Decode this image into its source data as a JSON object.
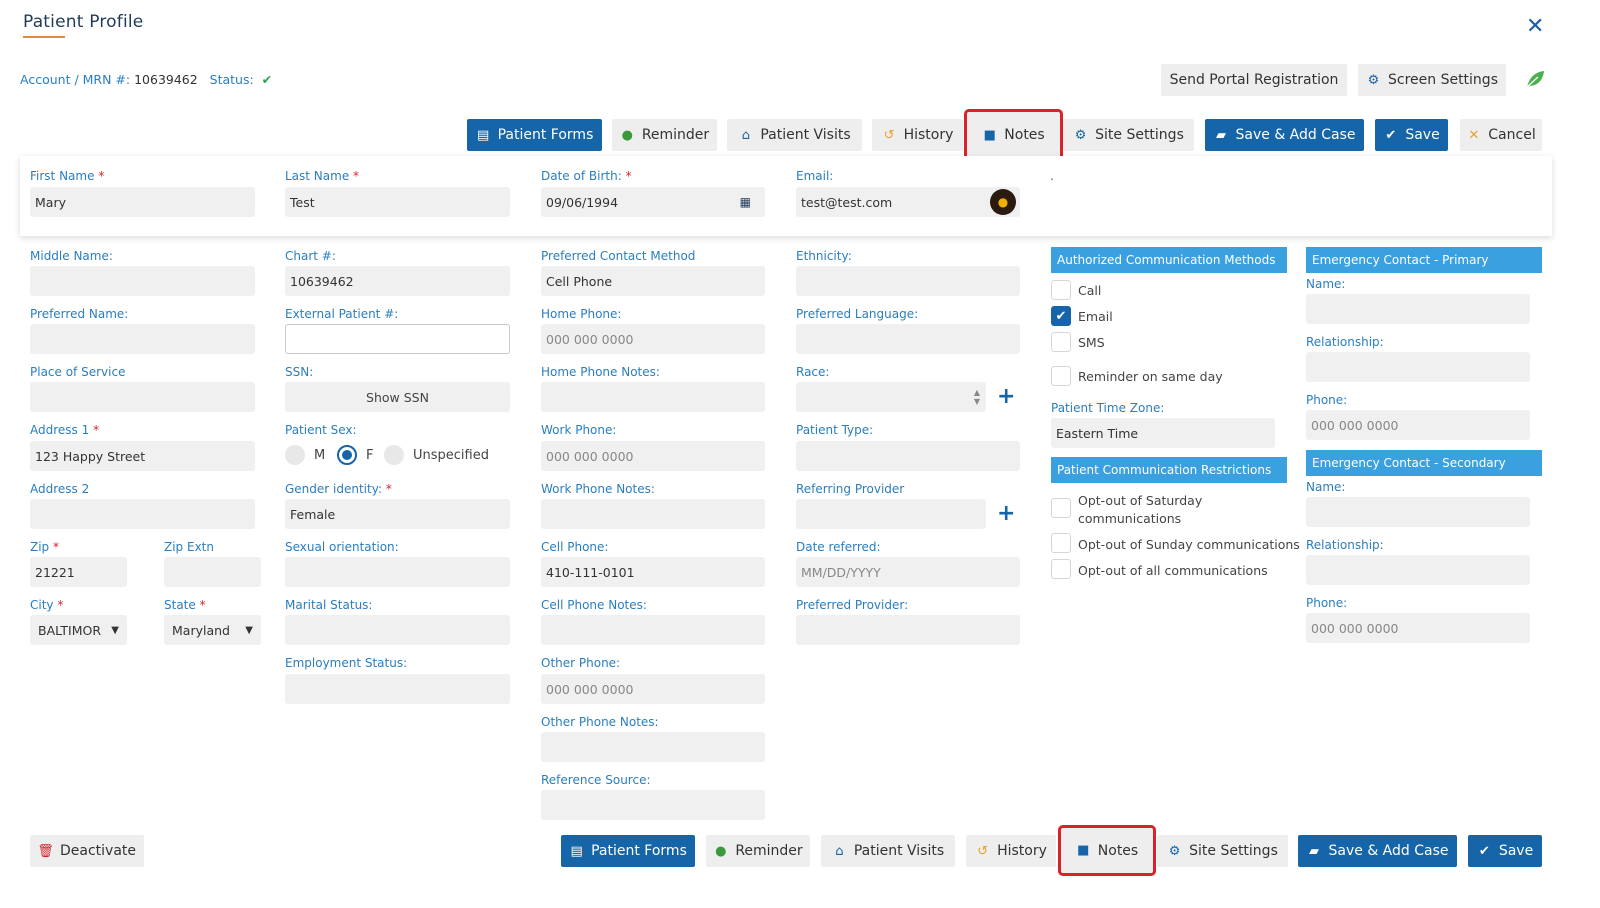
{
  "header": {
    "title": "Patient Profile",
    "account_label": "Account / MRN #:",
    "mrn": "10639462",
    "status_label": "Status:",
    "status_check": "✔"
  },
  "top_actions": {
    "send_portal": "Send Portal Registration",
    "screen_settings": "Screen Settings"
  },
  "toolbar": {
    "patient_forms": "Patient Forms",
    "reminder": "Reminder",
    "patient_visits": "Patient Visits",
    "history": "History",
    "notes": "Notes",
    "site_settings": "Site Settings",
    "save_add_case": "Save & Add Case",
    "save": "Save",
    "cancel": "Cancel",
    "deactivate": "Deactivate"
  },
  "card": {
    "first_name_label": "First Name",
    "first_name": "Mary",
    "last_name_label": "Last Name",
    "last_name": "Test",
    "dob_label": "Date of Birth:",
    "dob": "09/06/1994",
    "email_label": "Email:",
    "email": "test@test.com",
    "dot": "."
  },
  "col1": {
    "middle_name": "Middle Name:",
    "preferred_name": "Preferred Name:",
    "place_of_service": "Place of Service",
    "address1": "Address 1",
    "address1_value": "123 Happy Street",
    "address2": "Address 2",
    "zip": "Zip",
    "zip_value": "21221",
    "zip_extn": "Zip Extn",
    "city": "City",
    "city_value": "BALTIMOR",
    "state": "State",
    "state_value": "Maryland"
  },
  "col2": {
    "chart": "Chart #:",
    "chart_value": "10639462",
    "external_patient": "External Patient #:",
    "ssn": "SSN:",
    "show_ssn": "Show SSN",
    "patient_sex": "Patient Sex:",
    "sex_m": "M",
    "sex_f": "F",
    "sex_unspecified": "Unspecified",
    "gender_identity": "Gender identity:",
    "gender_value": "Female",
    "sexual_orientation": "Sexual orientation:",
    "marital_status": "Marital Status:",
    "employment_status": "Employment Status:"
  },
  "col3": {
    "preferred_contact": "Preferred Contact Method",
    "preferred_contact_value": "Cell Phone",
    "home_phone": "Home Phone:",
    "home_phone_ph": "000 000 0000",
    "home_phone_notes": "Home Phone Notes:",
    "work_phone": "Work Phone:",
    "work_phone_ph": "000 000 0000",
    "work_phone_notes": "Work Phone Notes:",
    "cell_phone": "Cell Phone:",
    "cell_phone_value": "410-111-0101",
    "cell_phone_notes": "Cell Phone Notes:",
    "other_phone": "Other Phone:",
    "other_phone_ph": "000 000 0000",
    "other_phone_notes": "Other Phone Notes:",
    "reference_source": "Reference Source:"
  },
  "col4": {
    "ethnicity": "Ethnicity:",
    "preferred_language": "Preferred Language:",
    "race": "Race:",
    "patient_type": "Patient Type:",
    "referring_provider": "Referring Provider",
    "date_referred": "Date referred:",
    "date_referred_ph": "MM/DD/YYYY",
    "preferred_provider": "Preferred Provider:"
  },
  "col5": {
    "auth_methods": "Authorized Communication Methods",
    "call": "Call",
    "email": "Email",
    "sms": "SMS",
    "reminder_same_day": "Reminder on same day",
    "time_zone": "Patient Time Zone:",
    "time_zone_value": "Eastern Time",
    "restrictions": "Patient Communication Restrictions",
    "opt_saturday_1": "Opt-out of Saturday",
    "opt_saturday_2": "communications",
    "opt_sunday": "Opt-out of Sunday communications",
    "opt_all": "Opt-out of all communications"
  },
  "col6": {
    "ec_primary": "Emergency Contact - Primary",
    "name": "Name:",
    "relationship": "Relationship:",
    "phone": "Phone:",
    "phone_ph": "000 000 0000",
    "ec_secondary": "Emergency Contact - Secondary"
  },
  "colors": {
    "primary": "#1565a8",
    "label": "#2a7ec0",
    "section": "#3aa0e0",
    "highlight": "#d9232a",
    "accent": "#e8893a"
  }
}
